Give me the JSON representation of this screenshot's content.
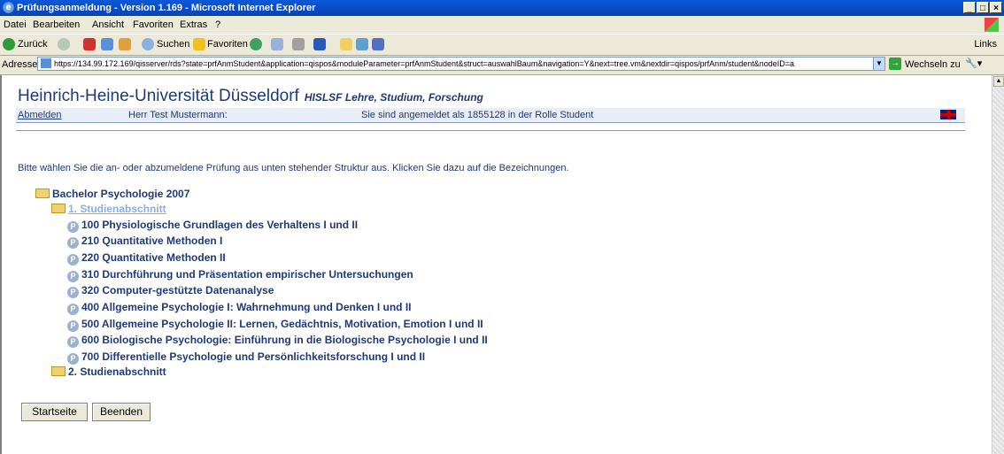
{
  "window": {
    "title": "Prüfungsanmeldung - Version 1.169 - Microsoft Internet Explorer",
    "controls": [
      "_",
      "□",
      "×"
    ]
  },
  "menubar": {
    "items": [
      "Datei",
      "Bearbeiten",
      "Ansicht",
      "Favoriten",
      "Extras",
      "?"
    ]
  },
  "toolbar": {
    "back_label": "Zurück",
    "search_label": "Suchen",
    "favorites_label": "Favoriten",
    "links_label": "Links"
  },
  "addressbar": {
    "label": "Adresse",
    "url": "https://134.99.172.169/qisserver/rds?state=prfAnmStudent&application=qispos&moduleParameter=prfAnmStudent&struct=auswahlBaum&navigation=Y&next=tree.vm&nextdir=qispos/prfAnm/student&nodeID=a",
    "go_label": "Wechseln zu"
  },
  "page": {
    "university": "Heinrich-Heine-Universität Düsseldorf",
    "subtitle": "HISLSF Lehre, Studium, Forschung",
    "logout": "Abmelden",
    "user": "Herr Test Mustermann:",
    "login_info": "Sie sind angemeldet als 1855128 in der Rolle Student",
    "instruction": "Bitte wählen Sie die an- oder abzumeldene Prüfung aus unten stehender Struktur aus. Klicken Sie dazu auf die Bezeichnungen.",
    "tree": {
      "root": "Bachelor Psychologie 2007",
      "section1": "1. Studienabschnitt",
      "exams": [
        "100 Physiologische Grundlagen des Verhaltens I und II",
        "210 Quantitative Methoden I",
        "220 Quantitative Methoden II",
        "310 Durchführung und Präsentation empirischer Untersuchungen",
        "320 Computer-gestützte Datenanalyse",
        "400 Allgemeine Psychologie I: Wahrnehmung und Denken I und II",
        "500 Allgemeine Psychologie II: Lernen, Gedächtnis, Motivation, Emotion I und II",
        "600 Biologische Psychologie: Einführung in die Biologische Psychologie I und II",
        "700 Differentielle Psychologie und Persönlichkeitsforschung I und II"
      ],
      "section2": "2. Studienabschnitt"
    },
    "buttons": {
      "start": "Startseite",
      "end": "Beenden"
    }
  }
}
